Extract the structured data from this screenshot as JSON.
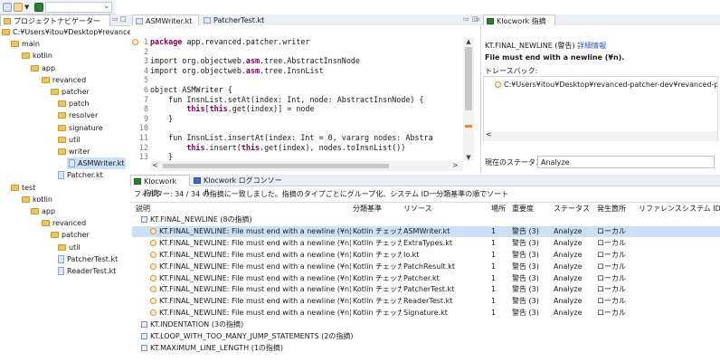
{
  "toolbar": {
    "combo_value": ""
  },
  "navigator": {
    "title": "プロジェクトナビゲーター",
    "tree": [
      {
        "label": "C:¥Users¥itou¥Desktop¥revanced",
        "kind": "folder",
        "depth": 0
      },
      {
        "label": "main",
        "kind": "folder",
        "depth": 1
      },
      {
        "label": "kotlin",
        "kind": "folder",
        "depth": 2
      },
      {
        "label": "app",
        "kind": "folder",
        "depth": 3
      },
      {
        "label": "revanced",
        "kind": "folder",
        "depth": 4
      },
      {
        "label": "patcher",
        "kind": "folder",
        "depth": 5
      },
      {
        "label": "patch",
        "kind": "folder",
        "depth": 6
      },
      {
        "label": "resolver",
        "kind": "folder",
        "depth": 6
      },
      {
        "label": "signature",
        "kind": "folder",
        "depth": 6
      },
      {
        "label": "util",
        "kind": "folder",
        "depth": 6
      },
      {
        "label": "writer",
        "kind": "folder",
        "depth": 6
      },
      {
        "label": "ASMWriter.kt",
        "kind": "file",
        "depth": 7,
        "selected": true
      },
      {
        "label": "Patcher.kt",
        "kind": "file",
        "depth": 6
      },
      {
        "label": "test",
        "kind": "folder",
        "depth": 1
      },
      {
        "label": "kotlin",
        "kind": "folder",
        "depth": 2
      },
      {
        "label": "app",
        "kind": "folder",
        "depth": 3
      },
      {
        "label": "revanced",
        "kind": "folder",
        "depth": 4
      },
      {
        "label": "patcher",
        "kind": "folder",
        "depth": 5
      },
      {
        "label": "util",
        "kind": "folder",
        "depth": 6
      },
      {
        "label": "PatcherTest.kt",
        "kind": "file",
        "depth": 6
      },
      {
        "label": "ReaderTest.kt",
        "kind": "file",
        "depth": 6
      }
    ]
  },
  "editor": {
    "tabs": [
      {
        "label": "ASMWriter.kt",
        "active": true
      },
      {
        "label": "PatcherTest.kt",
        "active": false
      }
    ],
    "lines": [
      {
        "n": "1",
        "segments": [
          {
            "t": "package",
            "kw": true
          },
          {
            "t": " app.revanced.patcher.writer",
            "kw": false
          }
        ]
      },
      {
        "n": "2",
        "segments": []
      },
      {
        "n": "3",
        "segments": [
          {
            "t": "import",
            "kw": false
          },
          {
            "t": " org.objectweb.",
            "kw": false
          },
          {
            "t": "asm",
            "kw": true
          },
          {
            "t": ".tree.AbstractInsnNode",
            "kw": false
          }
        ]
      },
      {
        "n": "4",
        "segments": [
          {
            "t": "import",
            "kw": false
          },
          {
            "t": " org.objectweb.",
            "kw": false
          },
          {
            "t": "asm",
            "kw": true
          },
          {
            "t": ".tree.InsnList",
            "kw": false
          }
        ]
      },
      {
        "n": "5",
        "segments": []
      },
      {
        "n": "6",
        "segments": [
          {
            "t": "object ASMWriter {",
            "kw": false
          }
        ]
      },
      {
        "n": "7",
        "segments": [
          {
            "t": "    fun InsnList.setAt(index: Int, node: AbstractInsnNode) {",
            "kw": false
          }
        ]
      },
      {
        "n": "8",
        "segments": [
          {
            "t": "        ",
            "kw": false
          },
          {
            "t": "this",
            "kw": true
          },
          {
            "t": "[",
            "kw": false
          },
          {
            "t": "this",
            "kw": true
          },
          {
            "t": ".get(index)] = node",
            "kw": false
          }
        ]
      },
      {
        "n": "9",
        "segments": [
          {
            "t": "    }",
            "kw": false
          }
        ]
      },
      {
        "n": "10",
        "segments": []
      },
      {
        "n": "11",
        "segments": [
          {
            "t": "    fun InsnList.insertAt(index: Int = 0, vararg nodes: Abstra",
            "kw": false
          }
        ]
      },
      {
        "n": "12",
        "segments": [
          {
            "t": "        ",
            "kw": false
          },
          {
            "t": "this",
            "kw": true
          },
          {
            "t": ".insert(",
            "kw": false
          },
          {
            "t": "this",
            "kw": true
          },
          {
            "t": ".get(index), nodes.toInsnList())",
            "kw": false
          }
        ]
      },
      {
        "n": "13",
        "segments": [
          {
            "t": "    }",
            "kw": false
          }
        ]
      }
    ]
  },
  "detail": {
    "tab_label": "Klocwork 指摘詳細",
    "issue_code": "KT.FINAL_NEWLINE (警告)",
    "detail_link": "詳細情報",
    "message": "File must end with a newline (¥n).",
    "traceback_label": "トレースバック:",
    "traceback_item": "C:¥Users¥itou¥Desktop¥revanced-patcher-dev¥revanced-patcher",
    "status_label": "現在のステータス:",
    "status_value": "Analyze"
  },
  "bottom": {
    "tabs": [
      {
        "label": "Klocwork 指摘",
        "active": true
      },
      {
        "label": "Klocwork ログコンソール",
        "active": false
      }
    ],
    "filter_text": "フィルター: 34 / 34 の指摘に一致しました。指摘のタイプごとにグループ化、システム ID一分類基準の順でソート",
    "columns": [
      "説明",
      "分類基準",
      "リソース",
      "場所",
      "重要度",
      "ステータス",
      "発生箇所",
      "リファレンス",
      "システム ID"
    ],
    "groups": [
      {
        "label": "KT.FINAL_NEWLINE (8の指摘)",
        "expanded": true,
        "rows": [
          {
            "desc": "KT.FINAL_NEWLINE: File must end with a newline (¥n)",
            "taxonomy": "Kotlin チェッカー",
            "resource": "ASMWriter.kt",
            "location": "1",
            "severity": "警告 (3)",
            "status": "Analyze",
            "occurrence": "ローカル",
            "selected": true
          },
          {
            "desc": "KT.FINAL_NEWLINE: File must end with a newline (¥n)",
            "taxonomy": "Kotlin チェッカー",
            "resource": "ExtraTypes.kt",
            "location": "1",
            "severity": "警告 (3)",
            "status": "Analyze",
            "occurrence": "ローカル"
          },
          {
            "desc": "KT.FINAL_NEWLINE: File must end with a newline (¥n)",
            "taxonomy": "Kotlin チェッカー",
            "resource": "Io.kt",
            "location": "1",
            "severity": "警告 (3)",
            "status": "Analyze",
            "occurrence": "ローカル"
          },
          {
            "desc": "KT.FINAL_NEWLINE: File must end with a newline (¥n)",
            "taxonomy": "Kotlin チェッカー",
            "resource": "PatchResult.kt",
            "location": "1",
            "severity": "警告 (3)",
            "status": "Analyze",
            "occurrence": "ローカル"
          },
          {
            "desc": "KT.FINAL_NEWLINE: File must end with a newline (¥n)",
            "taxonomy": "Kotlin チェッカー",
            "resource": "Patcher.kt",
            "location": "1",
            "severity": "警告 (3)",
            "status": "Analyze",
            "occurrence": "ローカル"
          },
          {
            "desc": "KT.FINAL_NEWLINE: File must end with a newline (¥n)",
            "taxonomy": "Kotlin チェッカー",
            "resource": "PatcherTest.kt",
            "location": "1",
            "severity": "警告 (3)",
            "status": "Analyze",
            "occurrence": "ローカル"
          },
          {
            "desc": "KT.FINAL_NEWLINE: File must end with a newline (¥n)",
            "taxonomy": "Kotlin チェッカー",
            "resource": "ReaderTest.kt",
            "location": "1",
            "severity": "警告 (3)",
            "status": "Analyze",
            "occurrence": "ローカル"
          },
          {
            "desc": "KT.FINAL_NEWLINE: File must end with a newline (¥n)",
            "taxonomy": "Kotlin チェッカー",
            "resource": "Signature.kt",
            "location": "1",
            "severity": "警告 (3)",
            "status": "Analyze",
            "occurrence": "ローカル"
          }
        ]
      },
      {
        "label": "KT.INDENTATION (3の指摘)",
        "expanded": false,
        "rows": []
      },
      {
        "label": "KT.LOOP_WITH_TOO_MANY_JUMP_STATEMENTS (2の指摘)",
        "expanded": false,
        "rows": []
      },
      {
        "label": "KT.MAXIMUM_LINE_LENGTH (1の指摘)",
        "expanded": false,
        "rows": []
      }
    ]
  },
  "colors": {
    "selection": "#cce1f7",
    "panel_header": "#eaeef5",
    "keyword": "#7f0055",
    "link": "#2a56c6",
    "warning": "#e8892a"
  }
}
